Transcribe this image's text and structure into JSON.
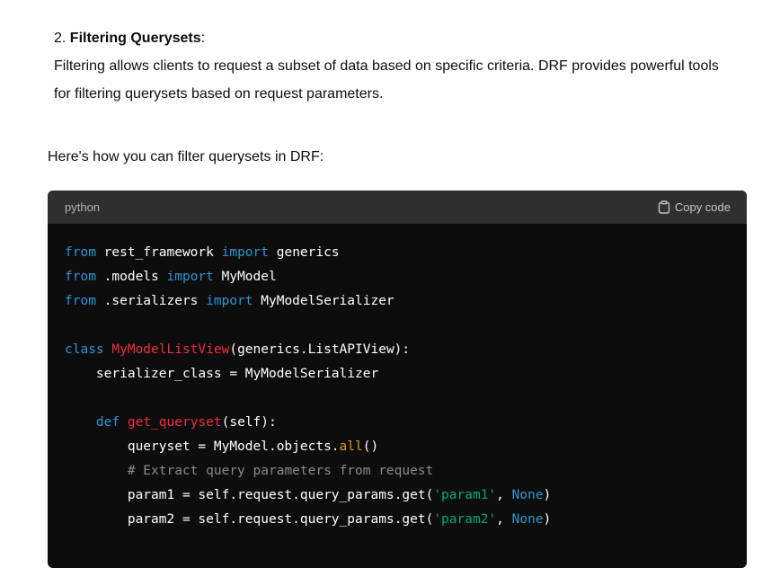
{
  "section": {
    "number": "2.",
    "title": "Filtering Querysets",
    "title_suffix": ":",
    "body": "Filtering allows clients to request a subset of data based on specific criteria. DRF provides powerful tools for filtering querysets based on request parameters."
  },
  "intro": "Here's how you can filter querysets in DRF:",
  "code_block": {
    "language": "python",
    "copy_label": "Copy code",
    "copy_icon": "clipboard-icon",
    "colors": {
      "keyword": "#2e95d3",
      "class_name": "#f22c3d",
      "string": "#00a67d",
      "comment": "#8a8a8a",
      "builtin": "#e9950c",
      "background": "#0d0d0d",
      "header": "#2f2f2f"
    },
    "lines": [
      [
        {
          "t": "kw",
          "v": "from"
        },
        {
          "t": "",
          "v": " rest_framework "
        },
        {
          "t": "kw",
          "v": "import"
        },
        {
          "t": "",
          "v": " generics"
        }
      ],
      [
        {
          "t": "kw",
          "v": "from"
        },
        {
          "t": "",
          "v": " .models "
        },
        {
          "t": "kw",
          "v": "import"
        },
        {
          "t": "",
          "v": " MyModel"
        }
      ],
      [
        {
          "t": "kw",
          "v": "from"
        },
        {
          "t": "",
          "v": " .serializers "
        },
        {
          "t": "kw",
          "v": "import"
        },
        {
          "t": "",
          "v": " MyModelSerializer"
        }
      ],
      [],
      [
        {
          "t": "kw",
          "v": "class"
        },
        {
          "t": "",
          "v": " "
        },
        {
          "t": "cls",
          "v": "MyModelListView"
        },
        {
          "t": "",
          "v": "(generics.ListAPIView):"
        }
      ],
      [
        {
          "t": "",
          "v": "    serializer_class = MyModelSerializer"
        }
      ],
      [],
      [
        {
          "t": "",
          "v": "    "
        },
        {
          "t": "kw",
          "v": "def"
        },
        {
          "t": "",
          "v": " "
        },
        {
          "t": "cls",
          "v": "get_queryset"
        },
        {
          "t": "",
          "v": "(self):"
        }
      ],
      [
        {
          "t": "",
          "v": "        queryset = MyModel.objects."
        },
        {
          "t": "bi",
          "v": "all"
        },
        {
          "t": "",
          "v": "()"
        }
      ],
      [
        {
          "t": "",
          "v": "        "
        },
        {
          "t": "cmt",
          "v": "# Extract query parameters from request"
        }
      ],
      [
        {
          "t": "",
          "v": "        param1 = self.request.query_params.get("
        },
        {
          "t": "str",
          "v": "'param1'"
        },
        {
          "t": "",
          "v": ", "
        },
        {
          "t": "kw",
          "v": "None"
        },
        {
          "t": "",
          "v": ")"
        }
      ],
      [
        {
          "t": "",
          "v": "        param2 = self.request.query_params.get("
        },
        {
          "t": "str",
          "v": "'param2'"
        },
        {
          "t": "",
          "v": ", "
        },
        {
          "t": "kw",
          "v": "None"
        },
        {
          "t": "",
          "v": ")"
        }
      ]
    ]
  }
}
